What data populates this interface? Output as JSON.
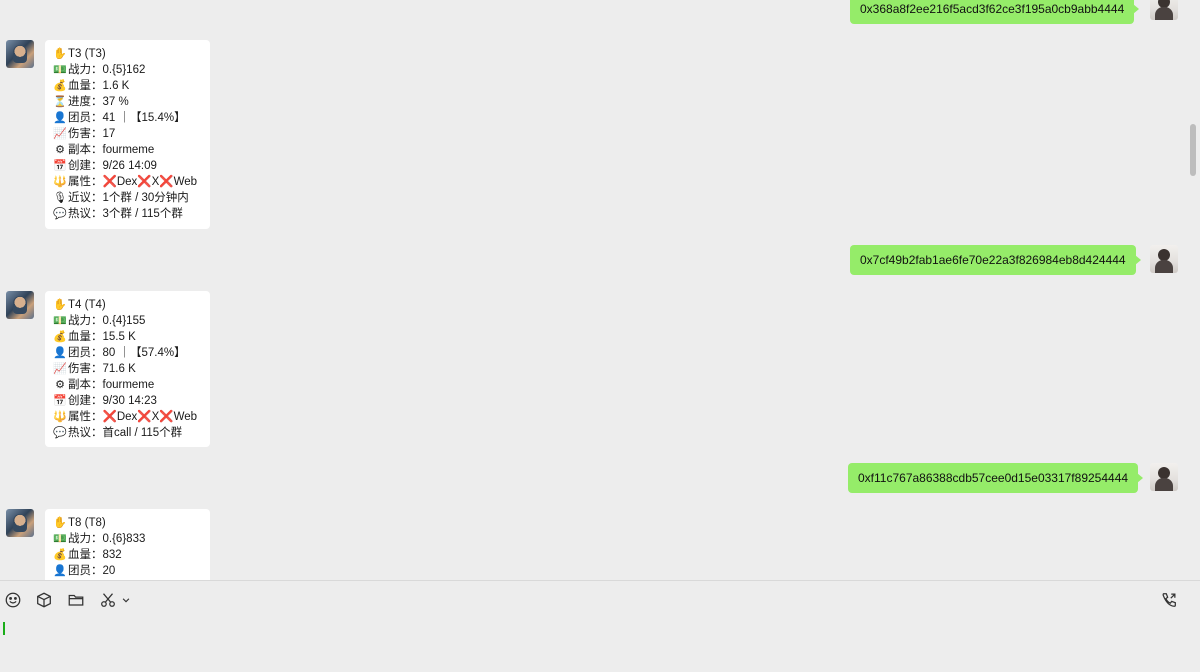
{
  "messages_right": [
    {
      "text": "0x368a8f2ee216f5acd3f62ce3f195a0cb9abb4444"
    },
    {
      "text": "0x7cf49b2fab1ae6fe70e22a3f826984eb8d424444"
    },
    {
      "text": "0xf11c767a86388cdb57cee0d15e03317f89254444"
    }
  ],
  "cards": [
    {
      "title": "T3 (T3)",
      "rows": [
        {
          "icon": "money-icon",
          "glyph": "💵",
          "text": "战力：0.{5}162"
        },
        {
          "icon": "moneybag-icon",
          "glyph": "💰",
          "text": "血量：1.6 K"
        },
        {
          "icon": "hourglass-icon",
          "glyph": "⏳",
          "text": "进度：37 %"
        },
        {
          "icon": "person-icon",
          "glyph": "👤",
          "text": "团员：41 ｜【15.4%】"
        },
        {
          "icon": "chart-icon",
          "glyph": "📈",
          "text": "伤害：17"
        },
        {
          "icon": "gear-icon",
          "glyph": "⚙",
          "text": "副本：fourmeme"
        },
        {
          "icon": "calendar-icon",
          "glyph": "📅",
          "text": "创建：9/26 14:09"
        },
        {
          "icon": "trident-icon",
          "glyph": "🔱",
          "text": "属性："
        },
        {
          "icon": "microphone-icon",
          "glyph": "🎙",
          "text": "近议：1个群 / 30分钟内"
        },
        {
          "icon": "speech-icon",
          "glyph": "💬",
          "text": "热议：3个群 / 115个群"
        }
      ],
      "attr": [
        "Dex",
        "X",
        "Web"
      ]
    },
    {
      "title": "T4 (T4)",
      "rows": [
        {
          "icon": "money-icon",
          "glyph": "💵",
          "text": "战力：0.{4}155"
        },
        {
          "icon": "moneybag-icon",
          "glyph": "💰",
          "text": "血量：15.5 K"
        },
        {
          "icon": "person-icon",
          "glyph": "👤",
          "text": "团员：80 ｜【57.4%】"
        },
        {
          "icon": "chart-icon",
          "glyph": "📈",
          "text": "伤害：71.6 K"
        },
        {
          "icon": "gear-icon",
          "glyph": "⚙",
          "text": "副本：fourmeme"
        },
        {
          "icon": "calendar-icon",
          "glyph": "📅",
          "text": "创建：9/30 14:23"
        },
        {
          "icon": "trident-icon",
          "glyph": "🔱",
          "text": "属性："
        },
        {
          "icon": "speech-icon",
          "glyph": "💬",
          "text": "热议：首call / 115个群"
        }
      ],
      "attr": [
        "Dex",
        "X",
        "Web"
      ]
    },
    {
      "title": "T8 (T8)",
      "rows": [
        {
          "icon": "money-icon",
          "glyph": "💵",
          "text": "战力：0.{6}833"
        },
        {
          "icon": "moneybag-icon",
          "glyph": "💰",
          "text": "血量：832"
        },
        {
          "icon": "person-icon",
          "glyph": "👤",
          "text": "团员：20"
        }
      ],
      "attr": []
    }
  ],
  "hand_glyph": "✋",
  "cross_glyph": "❌",
  "colors": {
    "bubble_right": "#95ec69",
    "bubble_left": "#ffffff",
    "background": "#ededed",
    "cross": "#e0322b",
    "caret": "#1aad19"
  },
  "toolbar": {
    "icons": [
      "emoji-icon",
      "box-icon",
      "folder-icon",
      "scissors-icon",
      "chevron-down-icon",
      "phone-icon"
    ]
  }
}
